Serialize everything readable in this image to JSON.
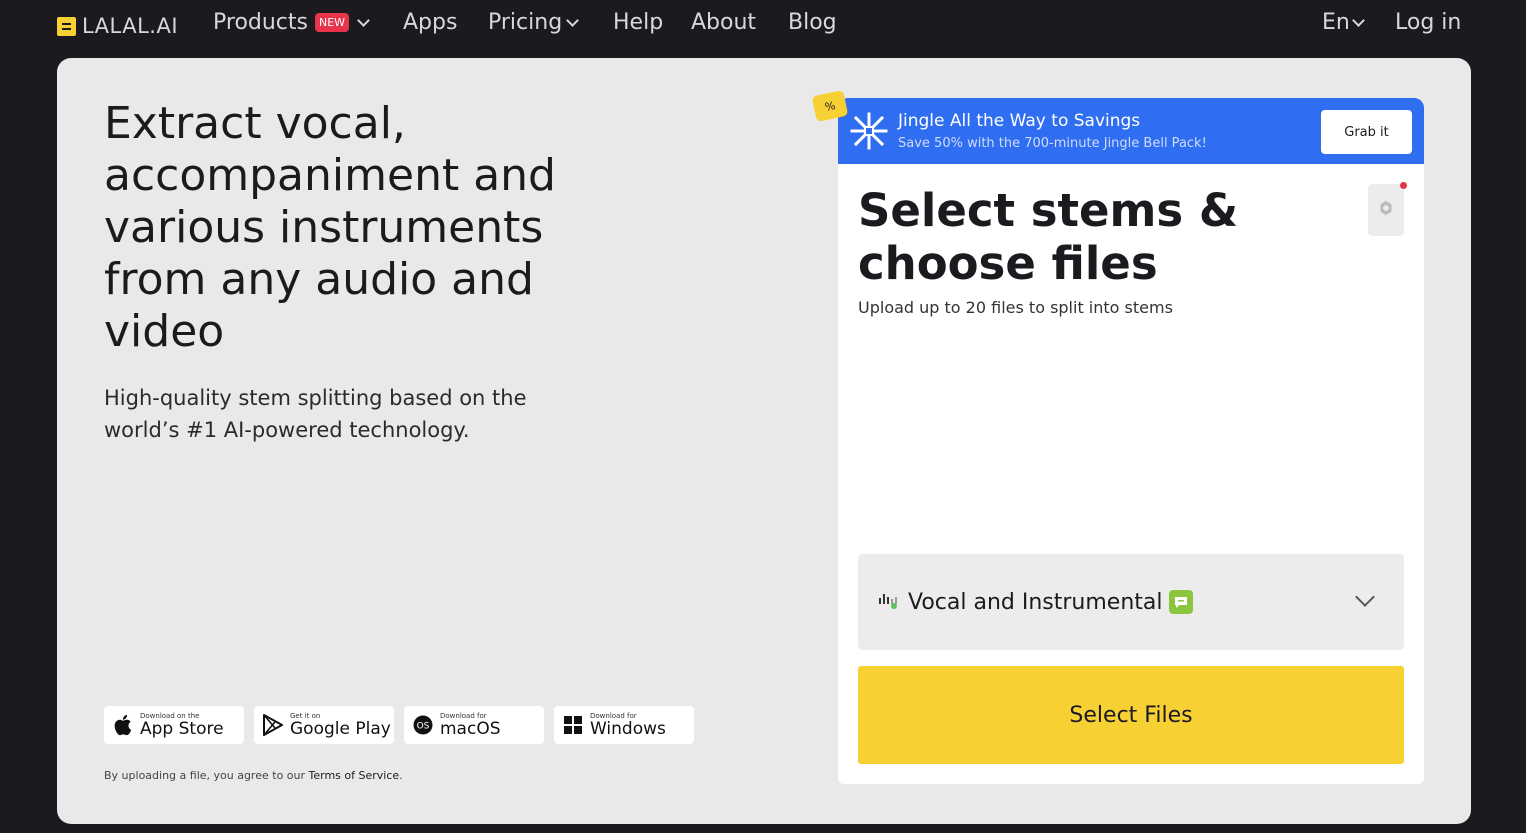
{
  "nav": {
    "logo_text": "LALAL.AI",
    "items": [
      {
        "label": "Products",
        "badge": "NEW"
      },
      {
        "label": "Apps"
      },
      {
        "label": "Pricing"
      },
      {
        "label": "Help"
      },
      {
        "label": "About"
      },
      {
        "label": "Blog"
      }
    ],
    "language": "En",
    "login": "Log in"
  },
  "hero": {
    "headline": "Extract vocal, accompaniment and various instruments from any audio and video",
    "subline": "High-quality stem splitting based on the world’s #1 AI-powered technology."
  },
  "stores": [
    {
      "small": "Download on the",
      "big": "App Store",
      "icon": "apple-icon"
    },
    {
      "small": "Get it on",
      "big": "Google Play",
      "icon": "google-play-icon"
    },
    {
      "small": "Download for",
      "big": "macOS",
      "icon": "macos-icon"
    },
    {
      "small": "Download for",
      "big": "Windows",
      "icon": "windows-icon"
    }
  ],
  "terms": {
    "prefix": "By uploading a file, you agree to our ",
    "link": "Terms of Service",
    "suffix": "."
  },
  "promo": {
    "tag": "%",
    "title": "Jingle All the Way to Savings",
    "subtitle": "Save 50% with the 700-minute Jingle Bell Pack!",
    "button": "Grab it"
  },
  "panel": {
    "title": "Select stems & choose files",
    "subtitle": "Upload up to 20 files to split into stems",
    "stem_option": "Vocal and Instrumental",
    "select_button": "Select Files"
  },
  "colors": {
    "background": "#1c1a1e",
    "card": "#e9e9e9",
    "accent_yellow": "#f7d133",
    "promo_blue": "#2f6ef0",
    "new_badge": "#e8344a",
    "stem_badge": "#8cc63f"
  }
}
